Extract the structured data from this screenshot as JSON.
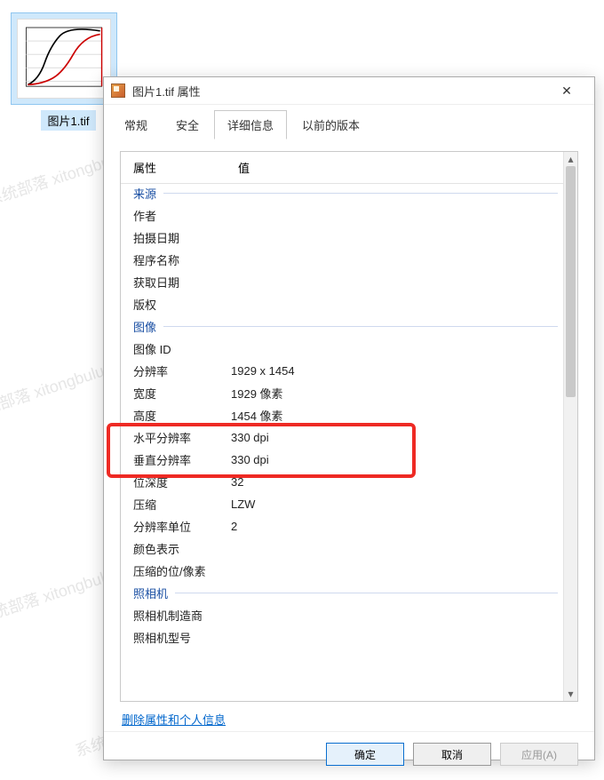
{
  "desktop": {
    "file_label": "图片1.tif"
  },
  "dialog": {
    "title": "图片1.tif 属性",
    "close_glyph": "✕",
    "tabs": [
      "常规",
      "安全",
      "详细信息",
      "以前的版本"
    ],
    "active_tab_index": 2,
    "header": {
      "prop": "属性",
      "val": "值"
    },
    "sections": {
      "origin": {
        "title": "来源",
        "rows": [
          {
            "label": "作者",
            "value": ""
          },
          {
            "label": "拍摄日期",
            "value": ""
          },
          {
            "label": "程序名称",
            "value": ""
          },
          {
            "label": "获取日期",
            "value": ""
          },
          {
            "label": "版权",
            "value": ""
          }
        ]
      },
      "image": {
        "title": "图像",
        "rows": [
          {
            "label": "图像 ID",
            "value": ""
          },
          {
            "label": "分辨率",
            "value": "1929 x 1454"
          },
          {
            "label": "宽度",
            "value": "1929 像素"
          },
          {
            "label": "高度",
            "value": "1454 像素"
          },
          {
            "label": "水平分辨率",
            "value": "330 dpi"
          },
          {
            "label": "垂直分辨率",
            "value": "330 dpi"
          },
          {
            "label": "位深度",
            "value": "32"
          },
          {
            "label": "压缩",
            "value": "LZW"
          },
          {
            "label": "分辨率单位",
            "value": "2"
          },
          {
            "label": "颜色表示",
            "value": ""
          },
          {
            "label": "压缩的位/像素",
            "value": ""
          }
        ]
      },
      "camera": {
        "title": "照相机",
        "rows": [
          {
            "label": "照相机制造商",
            "value": ""
          },
          {
            "label": "照相机型号",
            "value": ""
          }
        ]
      }
    },
    "remove_link": "删除属性和个人信息",
    "buttons": {
      "ok": "确定",
      "cancel": "取消",
      "apply": "应用(A)"
    }
  },
  "watermark_text": "系统部落 xitongbuluo.com"
}
